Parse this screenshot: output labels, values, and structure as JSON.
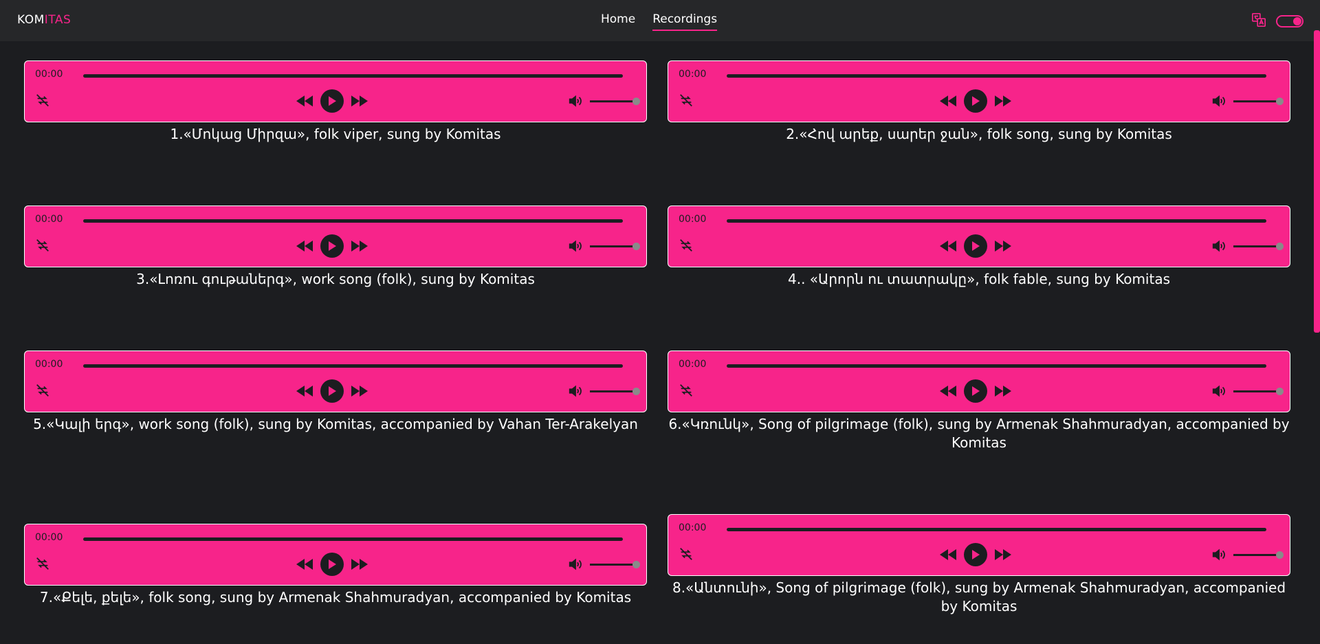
{
  "brand": {
    "prefix": "KOM",
    "suffix": "ITAS"
  },
  "nav": [
    {
      "label": "Home",
      "active": false
    },
    {
      "label": "Recordings",
      "active": true
    }
  ],
  "colors": {
    "accent": "#f7248a",
    "background": "#1c1d20",
    "navbar": "#262729"
  },
  "recordings": [
    {
      "time": "00:00",
      "title": "1.«Մոկաց Միրզա», folk viper, sung by Komitas"
    },
    {
      "time": "00:00",
      "title": "2.«Հով արեք, սարեր ջան», folk song, sung by Komitas"
    },
    {
      "time": "00:00",
      "title": "3.«Լոռու գութաներգ», work song (folk), sung by Komitas"
    },
    {
      "time": "00:00",
      "title": "4.. «Արորն ու տատրակը», folk fable, sung by Komitas"
    },
    {
      "time": "00:00",
      "title": "5.«Կալի երգ», work song (folk), sung by Komitas, accompanied by Vahan Ter-Arakelyan"
    },
    {
      "time": "00:00",
      "title": "6.«Կռունկ», Song of pilgrimage (folk), sung by Armenak Shahmuradyan, accompanied by Komitas"
    },
    {
      "time": "00:00",
      "title": "7.«Քելե, քելե», folk song, sung by Armenak Shahmuradyan, accompanied by Komitas"
    },
    {
      "time": "00:00",
      "title": "8.«Անտունի», Song of pilgrimage (folk), sung by Armenak Shahmuradyan, accompanied by Komitas"
    }
  ]
}
